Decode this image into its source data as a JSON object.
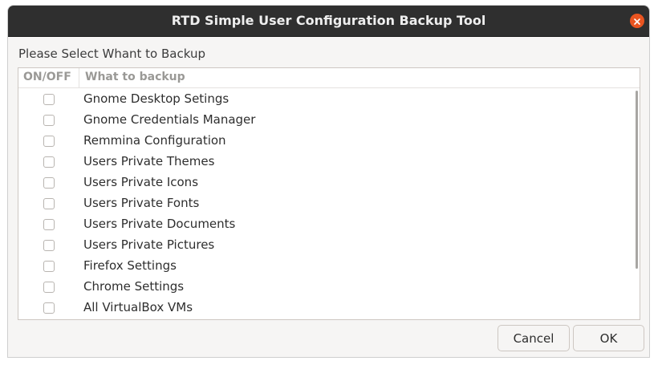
{
  "window": {
    "title": "RTD Simple User Configuration Backup Tool"
  },
  "prompt": "Please Select Whant to Backup",
  "table": {
    "columns": [
      "ON/OFF",
      "What to backup"
    ],
    "rows": [
      {
        "checked": false,
        "label": "Gnome Desktop Setings"
      },
      {
        "checked": false,
        "label": "Gnome Credentials Manager"
      },
      {
        "checked": false,
        "label": "Remmina Configuration"
      },
      {
        "checked": false,
        "label": "Users Private Themes"
      },
      {
        "checked": false,
        "label": "Users Private Icons"
      },
      {
        "checked": false,
        "label": "Users Private Fonts"
      },
      {
        "checked": false,
        "label": "Users Private Documents"
      },
      {
        "checked": false,
        "label": "Users Private Pictures"
      },
      {
        "checked": false,
        "label": "Firefox Settings"
      },
      {
        "checked": false,
        "label": "Chrome Settings"
      },
      {
        "checked": false,
        "label": "All VirtualBox VMs"
      }
    ]
  },
  "buttons": {
    "cancel": "Cancel",
    "ok": "OK"
  },
  "colors": {
    "titlebar": "#2f2f2f",
    "close_button": "#e95420",
    "dialog_background": "#f6f5f4"
  },
  "icons": {
    "close": "close-icon"
  }
}
